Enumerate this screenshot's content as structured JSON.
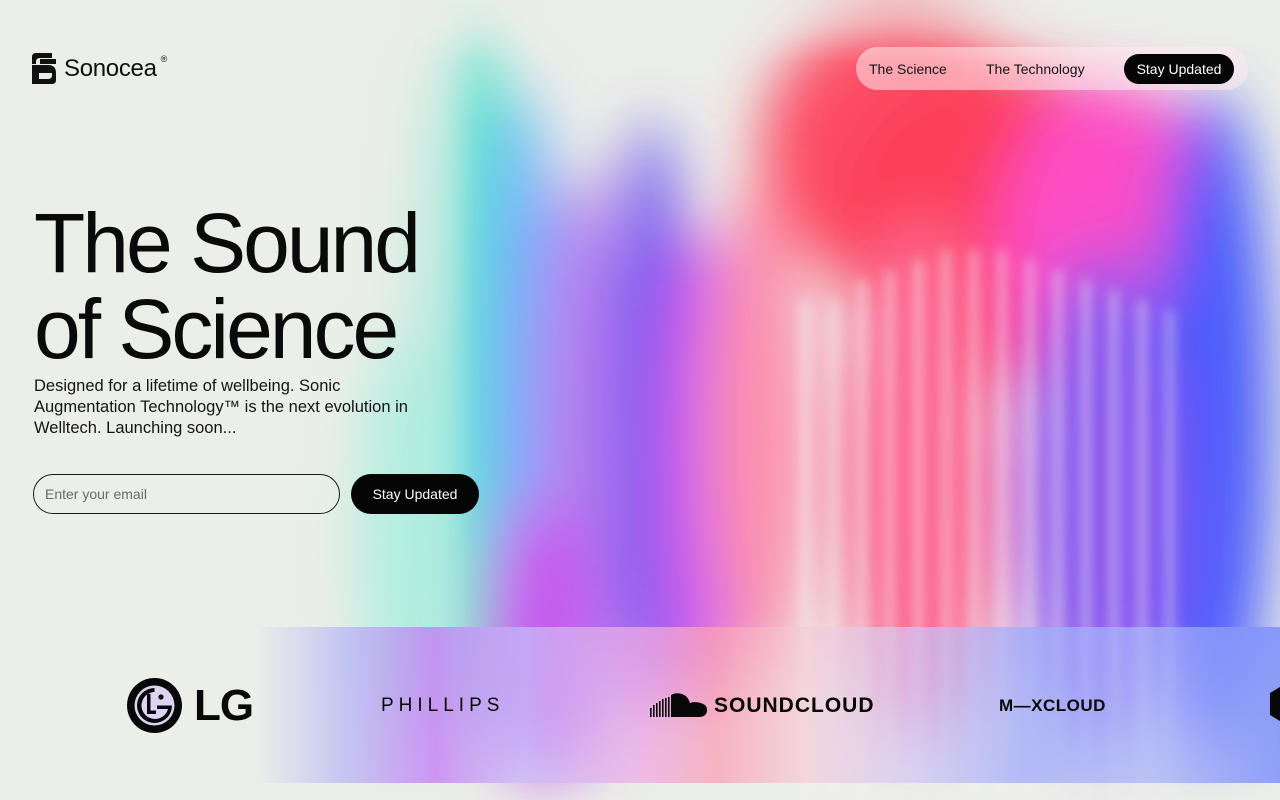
{
  "header": {
    "brand_name": "Sonocea",
    "brand_mark": "®",
    "nav": {
      "links": [
        "The Science",
        "The Technology"
      ],
      "cta_label": "Stay Updated"
    }
  },
  "hero": {
    "title_line1": "The Sound",
    "title_line2": "of Science",
    "subtitle": "Designed for a lifetime of wellbeing. Sonic Augmentation Technology™ is the next evolution in Welltech. Launching soon...",
    "email_placeholder": "Enter your email",
    "cta_label": "Stay Updated"
  },
  "partners": {
    "items": [
      {
        "name": "LG",
        "icon": "lg-logo-icon"
      },
      {
        "name": "PHILLIPS"
      },
      {
        "name": "SOUNDCLOUD",
        "icon": "soundcloud-icon"
      },
      {
        "name": "M—XCLOUD"
      }
    ]
  },
  "colors": {
    "background": "#eceee9",
    "ink": "#0b0b0b",
    "button_bg": "#050505",
    "button_text": "#ffffff",
    "wave_red": "#ff2a3a",
    "wave_blue": "#3a4cff",
    "wave_magenta": "#e03cf0",
    "wave_green": "#3cf0b0"
  }
}
